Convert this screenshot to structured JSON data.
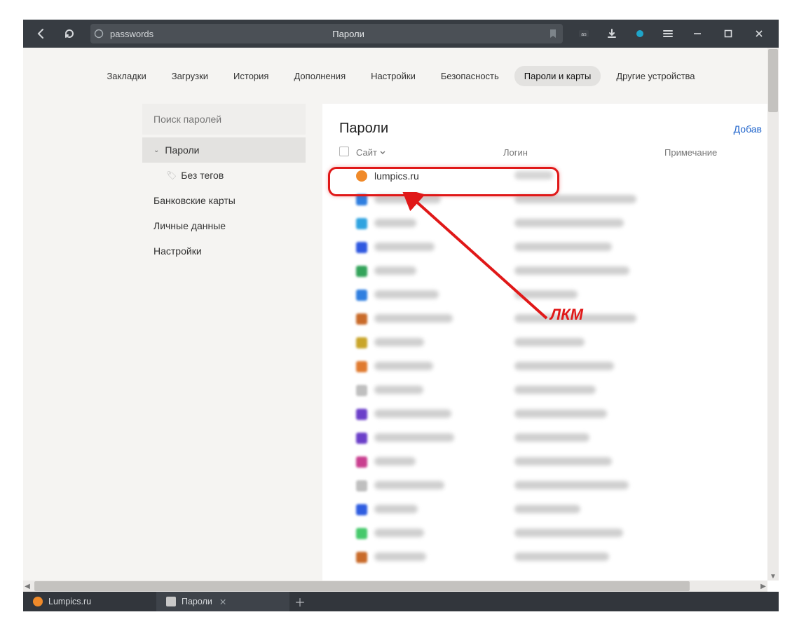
{
  "chrome": {
    "url_text": "passwords",
    "page_title": "Пароли"
  },
  "nav": [
    "Закладки",
    "Загрузки",
    "История",
    "Дополнения",
    "Настройки",
    "Безопасность",
    "Пароли и карты",
    "Другие устройства"
  ],
  "nav_active_index": 6,
  "sidebar": {
    "search_placeholder": "Поиск паролей",
    "items": [
      {
        "label": "Пароли",
        "expandable": true,
        "selected": true,
        "children": [
          {
            "label": "Без тегов"
          }
        ]
      },
      {
        "label": "Банковские карты"
      },
      {
        "label": "Личные данные"
      },
      {
        "label": "Настройки"
      }
    ]
  },
  "panel": {
    "title": "Пароли",
    "add_label": "Добав",
    "columns": {
      "site": "Сайт",
      "login": "Логин",
      "note": "Примечание"
    },
    "first_row": {
      "site": "lumpics.ru",
      "favicon_color": "#f08a2a"
    },
    "blurred_row_count": 16
  },
  "annotation": {
    "label": "ЛКМ"
  },
  "tabs": [
    {
      "label": "Lumpics.ru",
      "favicon_color": "#f08a2a",
      "active": false
    },
    {
      "label": "Пароли",
      "favicon_color": "#c8c8c8",
      "active": true
    }
  ]
}
